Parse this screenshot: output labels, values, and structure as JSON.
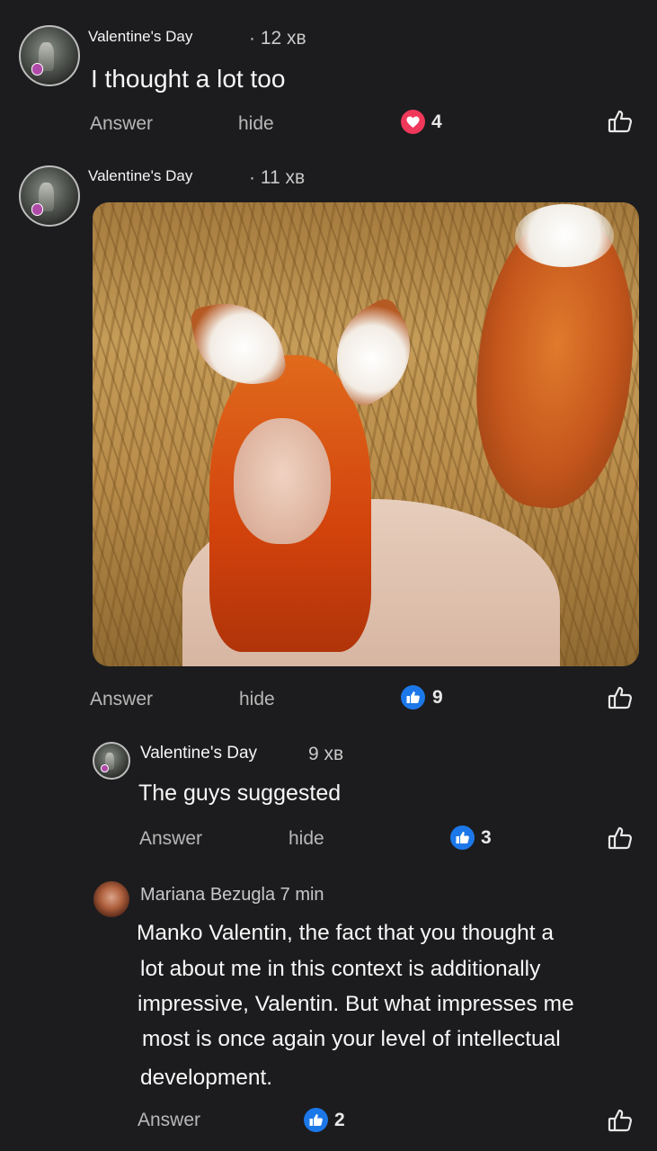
{
  "comments": [
    {
      "author": "Valentine's Day",
      "time": "· 12 хв",
      "text": "I thought a lot too",
      "actions": {
        "answer": "Answer",
        "hide": "hide"
      },
      "reaction": {
        "type": "heart",
        "count": "4"
      }
    },
    {
      "author": "Valentine's Day",
      "time": "· 11 хв",
      "actions": {
        "answer": "Answer",
        "hide": "hide"
      },
      "reaction": {
        "type": "like",
        "count": "9"
      }
    },
    {
      "author": "Valentine's Day",
      "time": "9 хв",
      "text": "The guys suggested",
      "actions": {
        "answer": "Answer",
        "hide": "hide"
      },
      "reaction": {
        "type": "like",
        "count": "3"
      }
    },
    {
      "author": "Mariana Bezugla 7 min",
      "lines": [
        "Manko Valentin, the fact that you thought a",
        "lot about me in this context is additionally",
        "impressive, Valentin. But what impresses me",
        "most is once again your level of intellectual",
        "development."
      ],
      "actions": {
        "answer": "Answer"
      },
      "reaction": {
        "type": "like",
        "count": "2"
      }
    }
  ],
  "colors": {
    "background": "#1c1c1e",
    "heart": "#f0385a",
    "like": "#1c78e8"
  }
}
